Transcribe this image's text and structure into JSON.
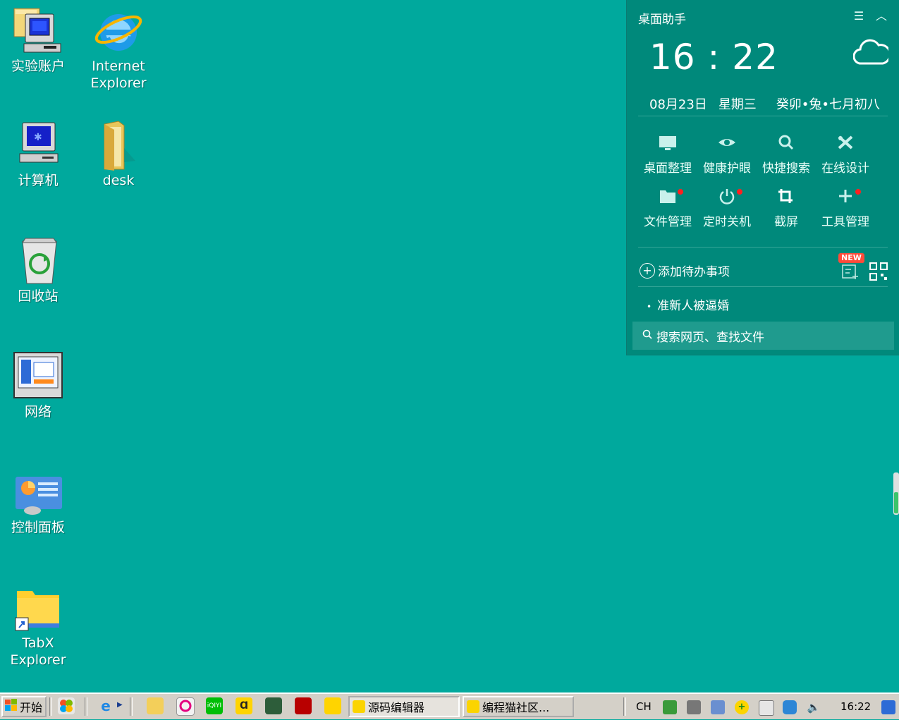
{
  "desktop": {
    "icons": [
      {
        "label": "实验账户",
        "icon": "computer-folder-icon"
      },
      {
        "label": "Internet\nExplorer",
        "icon": "internet-explorer-icon"
      },
      {
        "label": "计算机",
        "icon": "computer-icon"
      },
      {
        "label": "desk",
        "icon": "folder-icon"
      },
      {
        "label": "回收站",
        "icon": "recycle-bin-icon"
      },
      {
        "label": "网络",
        "icon": "network-icon"
      },
      {
        "label": "控制面板",
        "icon": "control-panel-icon"
      },
      {
        "label": "TabX\nExplorer",
        "icon": "folder-shortcut-icon"
      }
    ]
  },
  "widget": {
    "title": "桌面助手",
    "time": "16 : 22",
    "date": "08月23日",
    "weekday": "星期三",
    "lunar": "癸卯•兔•七月初八",
    "tools": [
      {
        "label": "桌面整理",
        "icon": "monitor-icon",
        "badge": false
      },
      {
        "label": "健康护眼",
        "icon": "eye-icon",
        "badge": false
      },
      {
        "label": "快捷搜索",
        "icon": "search-icon",
        "badge": false
      },
      {
        "label": "在线设计",
        "icon": "design-tools-icon",
        "badge": false
      },
      {
        "label": "文件管理",
        "icon": "folder-icon",
        "badge": true
      },
      {
        "label": "定时关机",
        "icon": "power-icon",
        "badge": true
      },
      {
        "label": "截屏",
        "icon": "crop-icon",
        "badge": false
      },
      {
        "label": "工具管理",
        "icon": "plus-icon",
        "badge": true
      }
    ],
    "todo_add": "添加待办事项",
    "new_badge": "NEW",
    "todo_items": [
      "准新人被逼婚"
    ],
    "search_placeholder": "搜索网页、查找文件"
  },
  "taskbar": {
    "start": "开始",
    "tasks": [
      "源码编辑器",
      "编程猫社区..."
    ],
    "lang": "CH",
    "clock": "16:22"
  }
}
